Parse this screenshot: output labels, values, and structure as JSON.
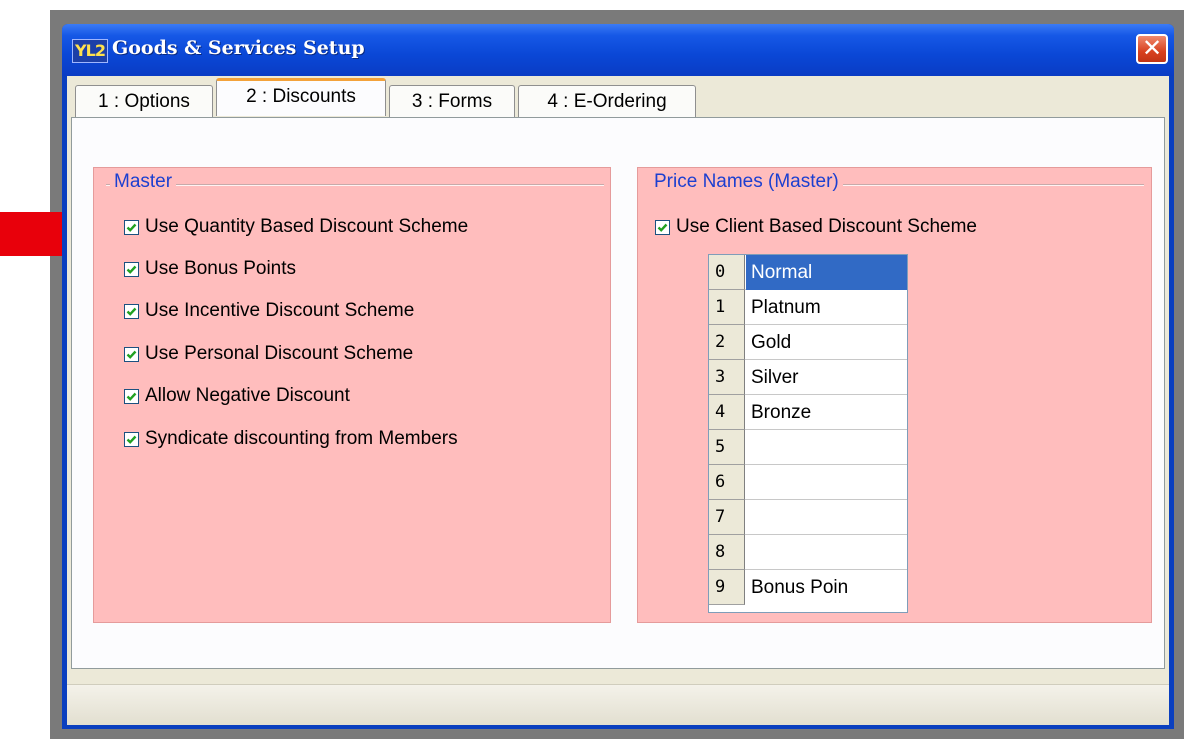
{
  "window": {
    "title": "Goods & Services Setup",
    "icon_text": "YL2",
    "close_symbol": "✕"
  },
  "tabs": [
    {
      "label": "1 : Options",
      "active": false
    },
    {
      "label": "2 : Discounts",
      "active": true
    },
    {
      "label": "3 : Forms",
      "active": false
    },
    {
      "label": "4 : E-Ordering",
      "active": false
    }
  ],
  "master": {
    "title": "Master",
    "options": [
      {
        "label": "Use Quantity Based Discount Scheme",
        "checked": true
      },
      {
        "label": "Use Bonus Points",
        "checked": true
      },
      {
        "label": "Use Incentive Discount Scheme",
        "checked": true
      },
      {
        "label": "Use Personal  Discount Scheme",
        "checked": true
      },
      {
        "label": "Allow Negative Discount",
        "checked": true
      },
      {
        "label": "Syndicate discounting from Members",
        "checked": true
      }
    ]
  },
  "price_names": {
    "title": "Price Names (Master)",
    "client_scheme_label": "Use Client Based Discount Scheme",
    "client_scheme_checked": true,
    "rows": [
      {
        "num": "0",
        "name": "Normal",
        "selected": true
      },
      {
        "num": "1",
        "name": "Platnum"
      },
      {
        "num": "2",
        "name": "Gold"
      },
      {
        "num": "3",
        "name": "Silver"
      },
      {
        "num": "4",
        "name": "Bronze"
      },
      {
        "num": "5",
        "name": ""
      },
      {
        "num": "6",
        "name": ""
      },
      {
        "num": "7",
        "name": ""
      },
      {
        "num": "8",
        "name": ""
      },
      {
        "num": "9",
        "name": "Bonus Poin"
      }
    ]
  },
  "colors": {
    "panel_bg": "#ffbdbd",
    "group_title": "#1c3fd0",
    "arrow": "#e8000b",
    "selection": "#316ac5"
  }
}
